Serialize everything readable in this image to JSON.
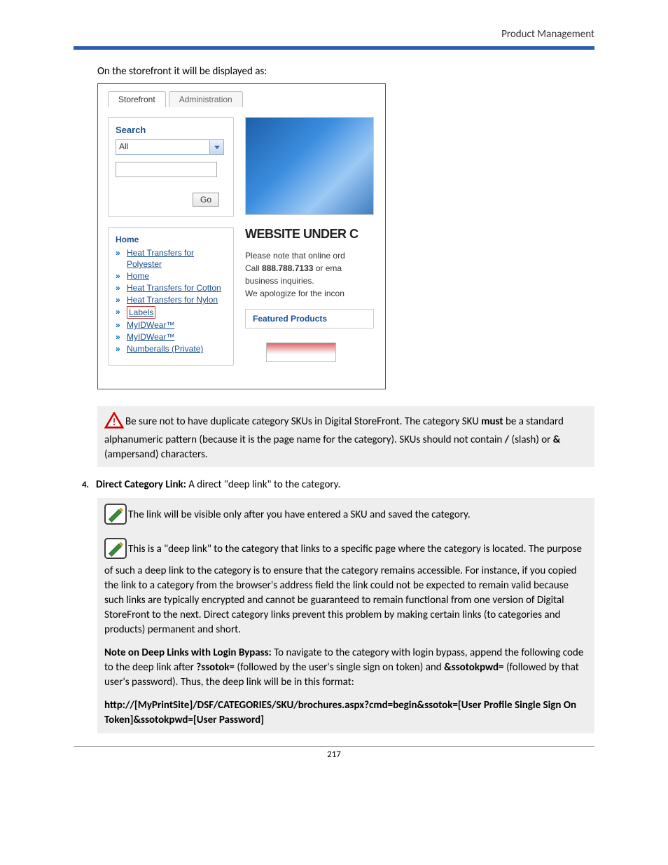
{
  "header": {
    "title": "Product Management"
  },
  "intro": "On the storefront it will be displayed as:",
  "screenshot": {
    "tabs": {
      "storefront": "Storefront",
      "administration": "Administration"
    },
    "search": {
      "heading": "Search",
      "select_value": "All",
      "go": "Go"
    },
    "nav": {
      "home": "Home",
      "items": [
        {
          "label": "Heat Transfers for Polyester"
        },
        {
          "label": "Home"
        },
        {
          "label": "Heat Transfers for Cotton"
        },
        {
          "label": "Heat Transfers for Nylon"
        },
        {
          "label": "Labels",
          "boxed": true
        },
        {
          "label": "MyIDWear™"
        },
        {
          "label": "MyIDWear™"
        },
        {
          "label": "Numberalls (Private)"
        }
      ]
    },
    "content": {
      "heading": "WEBSITE UNDER C",
      "line1a": "Please note that online ord",
      "line2_pre": "Call ",
      "line2_phone": "888.788.7133",
      "line2_post": " or ema",
      "line3": "business inquiries.",
      "line4": "We apologize for the incon",
      "featured": "Featured Products"
    }
  },
  "callout": {
    "pre": "Be sure not to have duplicate category SKUs in Digital StoreFront. The category SKU ",
    "must": "must",
    "mid": " be a standard alphanumeric pattern (because it is the page name for the category). SKUs should not contain ",
    "slash": "/",
    "slash_label": " (slash) or ",
    "amp": "&",
    "amp_label": " (ampersand) characters."
  },
  "item4": {
    "number": "4.",
    "heading": "Direct Category Link:",
    "body": " A direct \"deep link\" to the category."
  },
  "notes": {
    "n1": "The link will be visible only after you have entered a SKU and saved the category.",
    "n2": "This is a \"deep link\" to the category that links to a specific page where the category is located. The purpose of such a deep link to the category is to ensure that the category remains accessible. For instance, if you copied the link to a category from the browser's address field the link could not be expected to remain valid because such links are typically encrypted and cannot be guaranteed to remain functional from one version of Digital StoreFront to the next. Direct category links prevent this problem by making certain links (to categories and products) permanent and short.",
    "n3_head": "Note on Deep Links with Login Bypass:",
    "n3a": " To navigate to the category with login bypass, append the following code to the deep link after ",
    "n3b": "?ssotok=",
    "n3c": " (followed by the user's single sign on token) and ",
    "n3d": "&ssotokpwd=",
    "n3e": " (followed by that user's password). Thus, the deep link will be in this format:",
    "n4": "http://[MyPrintSite]/DSF/CATEGORIES/SKU/brochures.aspx?cmd=begin&ssotok=[User Profile Single Sign On Token]&ssotokpwd=[User Password]"
  },
  "page_number": "217"
}
